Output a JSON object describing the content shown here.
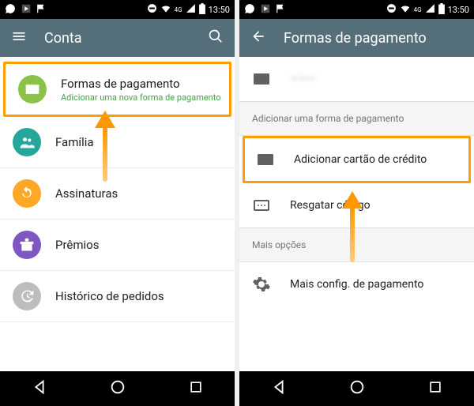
{
  "status": {
    "time": "13:50",
    "network": "4G"
  },
  "left": {
    "title": "Conta",
    "items": [
      {
        "title": "Formas de pagamento",
        "sub": "Adicionar uma nova forma de pagamento"
      },
      {
        "title": "Família"
      },
      {
        "title": "Assinaturas"
      },
      {
        "title": "Prêmios"
      },
      {
        "title": "Histórico de pedidos"
      }
    ]
  },
  "right": {
    "title": "Formas de pagamento",
    "section1": "Adicionar uma forma de pagamento",
    "add_card": "Adicionar cartão de crédito",
    "redeem": "Resgatar código",
    "section2": "Mais opções",
    "more_settings": "Mais config. de pagamento",
    "existing": "———"
  }
}
